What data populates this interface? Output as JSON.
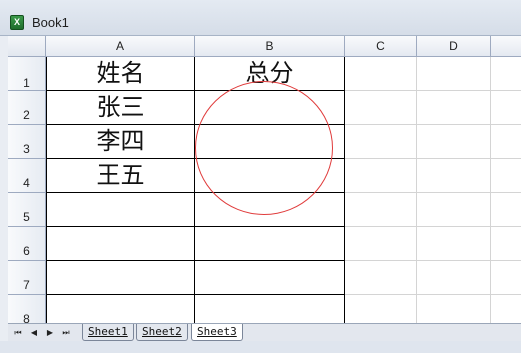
{
  "window": {
    "title": "Book1",
    "app_icon_glyph": "X",
    "app_icon": "excel-icon"
  },
  "columns": [
    "A",
    "B",
    "C",
    "D"
  ],
  "rows": [
    "1",
    "2",
    "3",
    "4",
    "5",
    "6",
    "7",
    "8"
  ],
  "cells": {
    "A1": "姓名",
    "B1": "总分",
    "A2": "张三",
    "A3": "李四",
    "A4": "王五"
  },
  "annotation": {
    "shape": "circle",
    "color": "#e03c3c"
  },
  "sheet_tabs": [
    {
      "label": "Sheet1",
      "active": false
    },
    {
      "label": "Sheet2",
      "active": false
    },
    {
      "label": "Sheet3",
      "active": true
    }
  ],
  "nav_buttons": [
    {
      "name": "first-sheet-button",
      "glyph": "⏮"
    },
    {
      "name": "prev-sheet-button",
      "glyph": "◀"
    },
    {
      "name": "next-sheet-button",
      "glyph": "▶"
    },
    {
      "name": "last-sheet-button",
      "glyph": "⏭"
    }
  ]
}
